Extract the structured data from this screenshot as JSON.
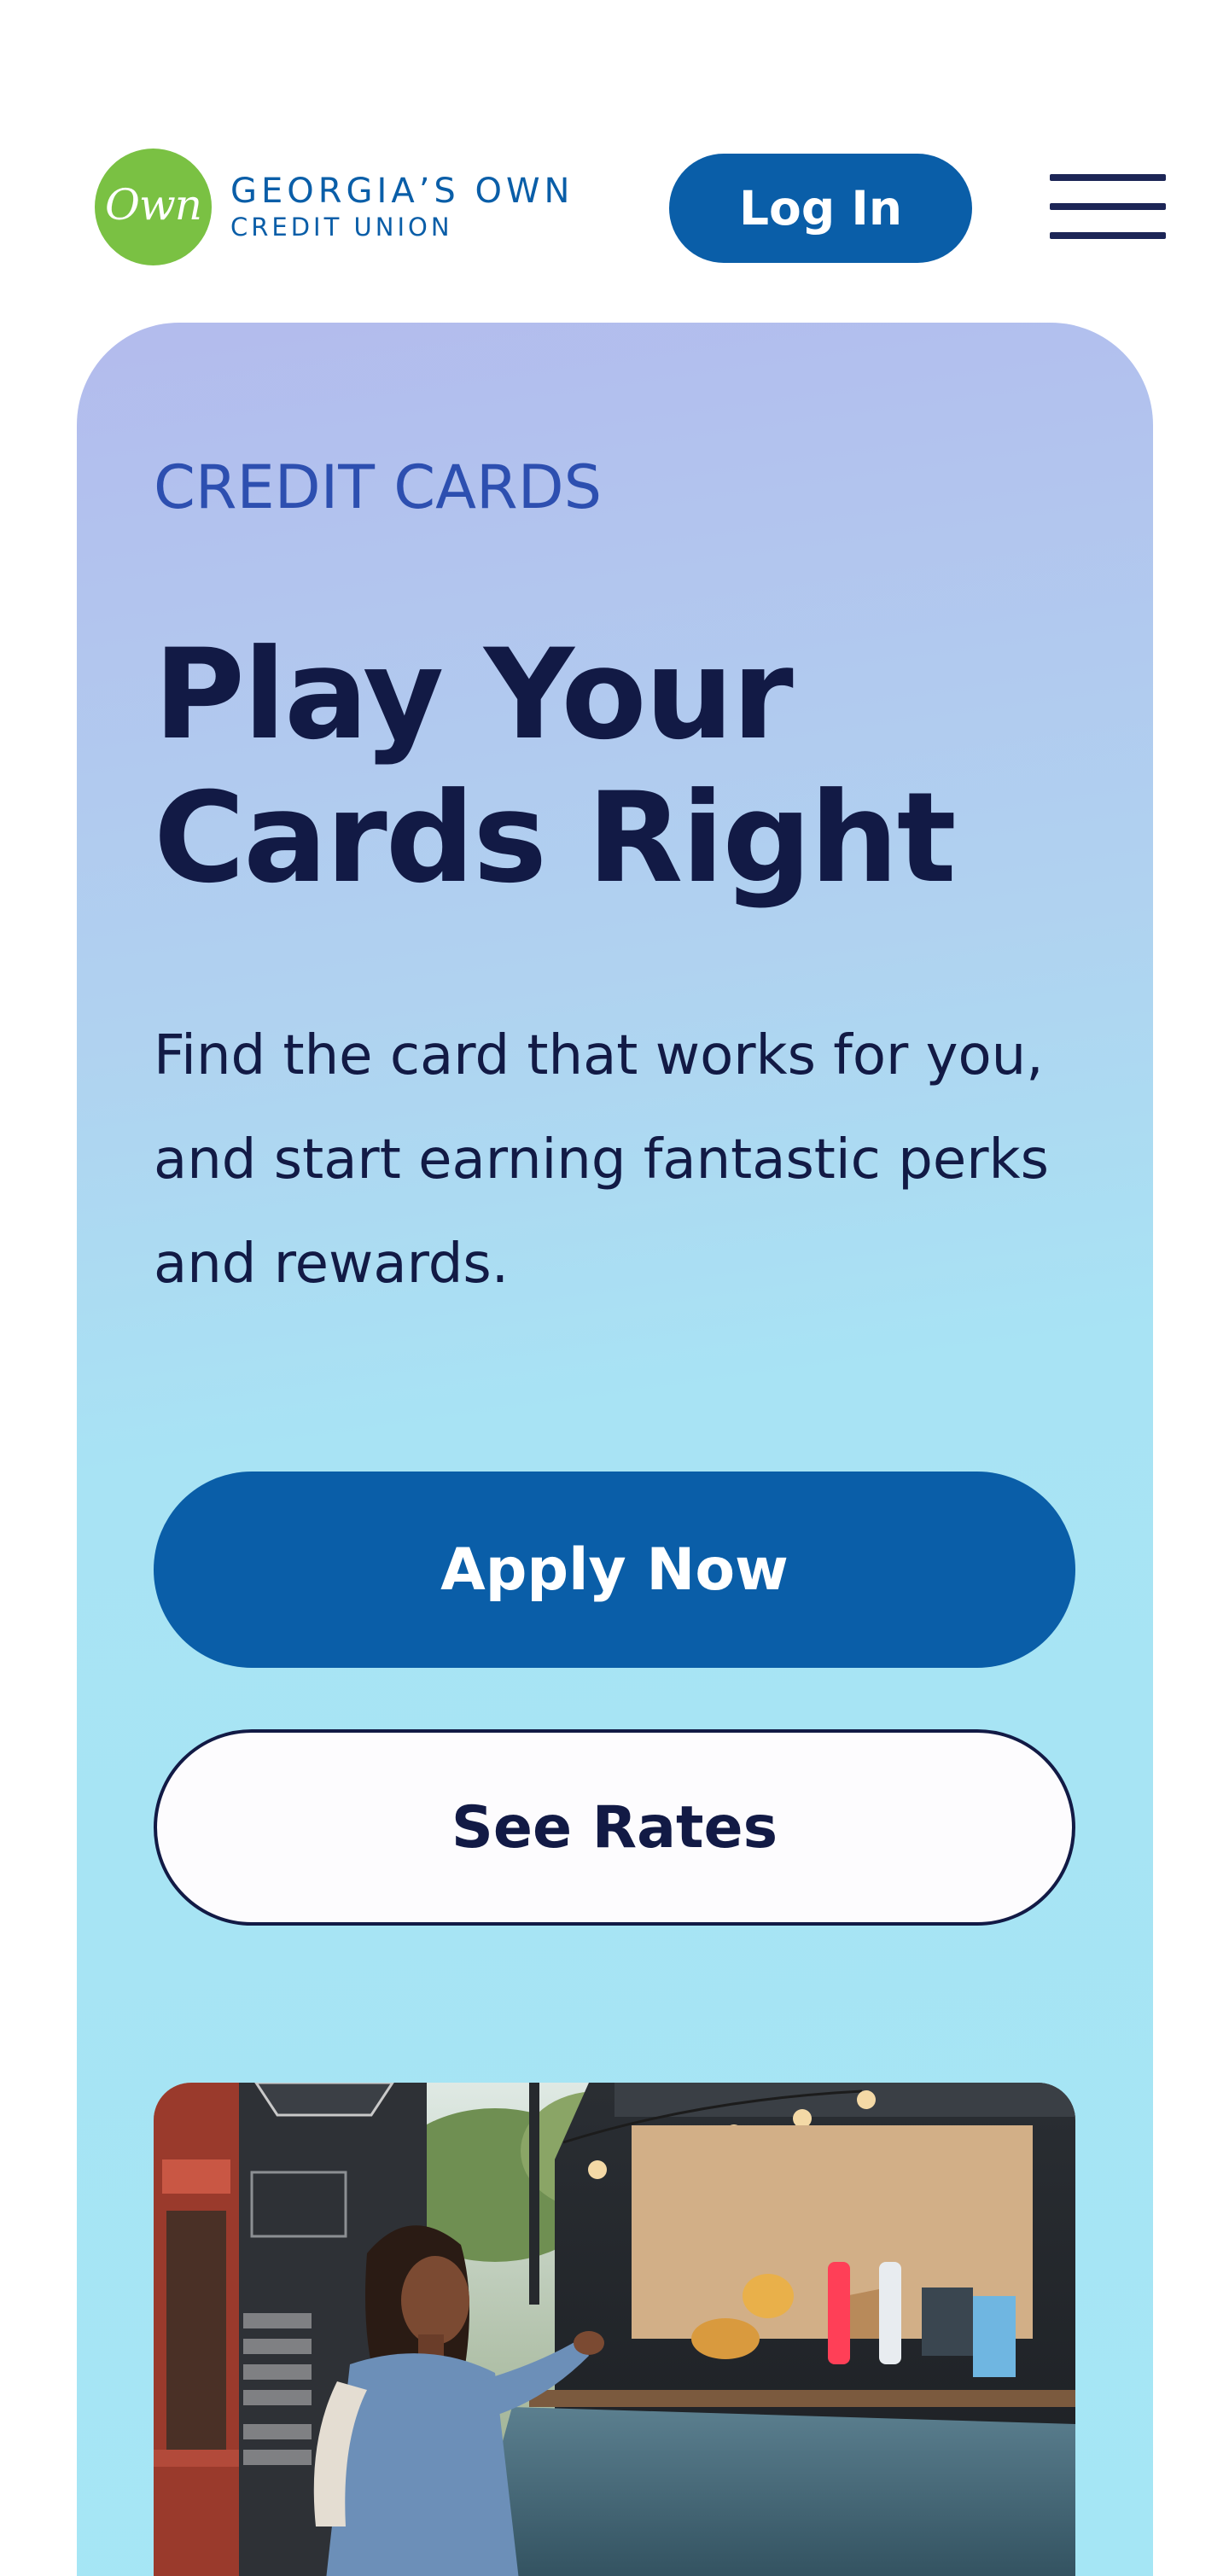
{
  "header": {
    "logo_mark": "Own",
    "logo_name": "GEORGIA’S OWN",
    "logo_sub": "CREDIT UNION",
    "login_label": "Log In",
    "menu_icon": "hamburger-menu-icon"
  },
  "hero": {
    "eyebrow": "CREDIT CARDS",
    "title": "Play Your Cards Right",
    "description": "Find the card that works for you, and start earning fantastic perks and rewards.",
    "apply_label": "Apply Now",
    "rates_label": "See Rates",
    "image_subject": "woman at a food truck counter"
  },
  "colors": {
    "brand_blue": "#0a5ea8",
    "logo_green": "#7ac143",
    "text_navy": "#121a45",
    "eyebrow_blue": "#2d4fb0"
  }
}
